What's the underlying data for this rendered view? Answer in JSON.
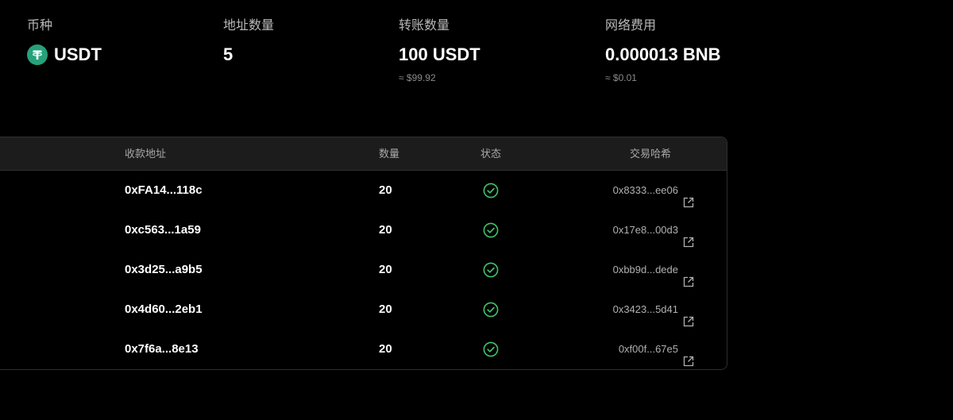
{
  "summary": {
    "currency": {
      "label": "币种",
      "value": "USDT",
      "icon": "tether-icon",
      "icon_color": "#26a17b"
    },
    "address_count": {
      "label": "地址数量",
      "value": "5"
    },
    "transfer_amount": {
      "label": "转账数量",
      "value": "100 USDT",
      "sub": "≈ $99.92"
    },
    "network_fee": {
      "label": "网络费用",
      "value": "0.000013 BNB",
      "sub": "≈ $0.01"
    }
  },
  "table": {
    "columns": {
      "address": "收款地址",
      "amount": "数量",
      "status": "状态",
      "hash": "交易哈希"
    },
    "rows": [
      {
        "address": "0xFA14...118c",
        "amount": "20",
        "status": "success-icon",
        "hash": "0x8333...ee06"
      },
      {
        "address": "0xc563...1a59",
        "amount": "20",
        "status": "success-icon",
        "hash": "0x17e8...00d3"
      },
      {
        "address": "0x3d25...a9b5",
        "amount": "20",
        "status": "success-icon",
        "hash": "0xbb9d...dede"
      },
      {
        "address": "0x4d60...2eb1",
        "amount": "20",
        "status": "success-icon",
        "hash": "0x3423...5d41"
      },
      {
        "address": "0x7f6a...8e13",
        "amount": "20",
        "status": "success-icon",
        "hash": "0xf00f...67e5"
      }
    ],
    "status_color": "#3fc46a"
  }
}
